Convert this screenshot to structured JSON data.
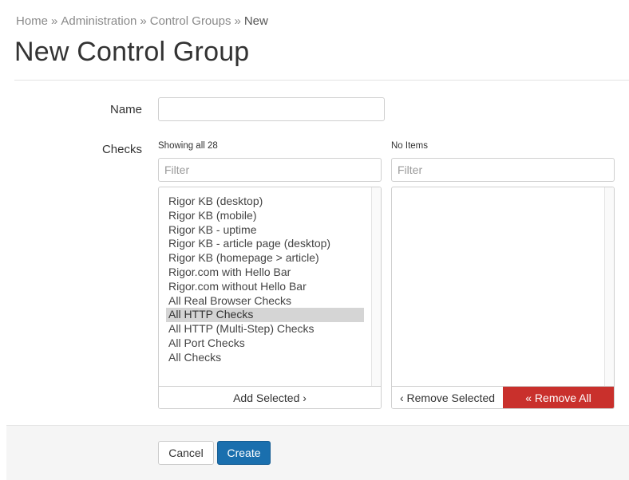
{
  "breadcrumb": {
    "items": [
      "Home",
      "Administration",
      "Control Groups"
    ],
    "separator": "»",
    "current": "New"
  },
  "page": {
    "title": "New Control Group"
  },
  "form": {
    "name_label": "Name",
    "name_value": "",
    "checks_label": "Checks"
  },
  "available": {
    "caption": "Showing all 28",
    "filter_placeholder": "Filter",
    "items": [
      "Rigor KB (desktop)",
      "Rigor KB (mobile)",
      "Rigor KB - uptime",
      "Rigor KB - article page (desktop)",
      "Rigor KB (homepage > article)",
      "Rigor.com with Hello Bar",
      "Rigor.com without Hello Bar",
      "All Real Browser Checks",
      "All HTTP Checks",
      "All HTTP (Multi-Step) Checks",
      "All Port Checks",
      "All Checks"
    ],
    "selected_item": "All HTTP Checks",
    "add_button": "Add Selected ›"
  },
  "chosen": {
    "caption": "No Items",
    "filter_placeholder": "Filter",
    "remove_selected_button": "‹ Remove Selected",
    "remove_all_button": "« Remove All"
  },
  "actions": {
    "cancel_label": "Cancel",
    "create_label": "Create"
  },
  "colors": {
    "primary": "#1a6fae",
    "danger": "#c9302c",
    "selected_row": "#d5d5d5"
  }
}
